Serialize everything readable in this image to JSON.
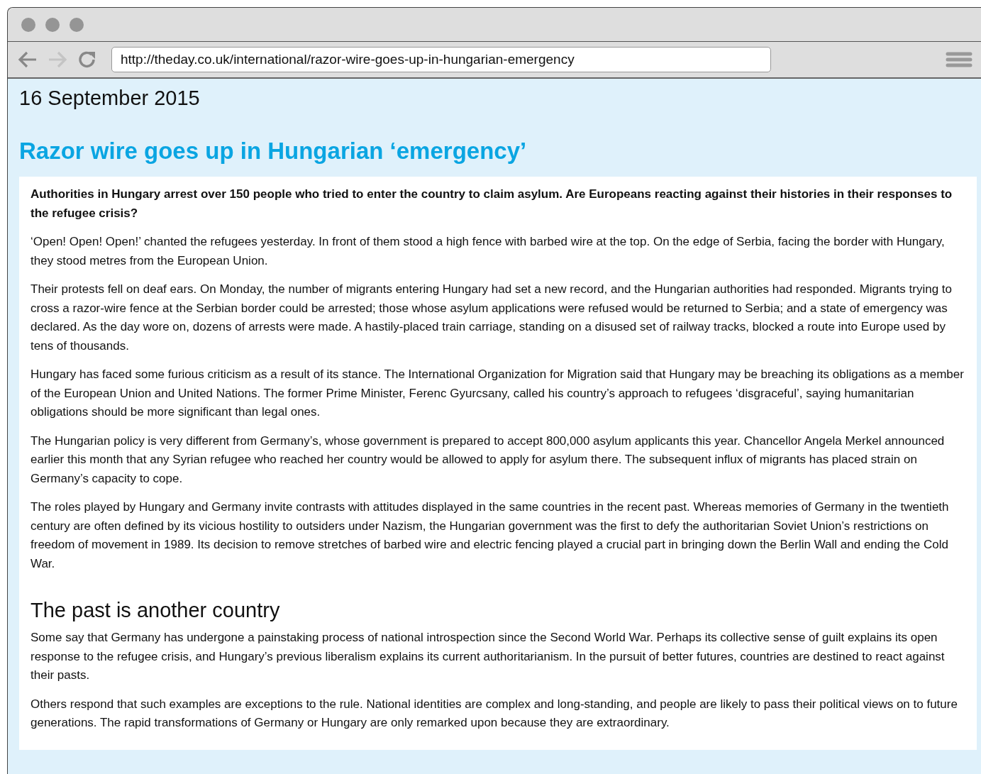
{
  "browser": {
    "url": "http://theday.co.uk/international/razor-wire-goes-up-in-hungarian-emergency"
  },
  "page": {
    "date": "16 September 2015",
    "title": "Razor wire goes up in Hungarian ‘emergency’",
    "blocks": [
      {
        "kind": "lead",
        "text": "Authorities in Hungary arrest over 150 people who tried to enter the country to claim asylum. Are Europeans reacting against their histories in their responses to the refugee crisis?"
      },
      {
        "kind": "paragraph",
        "text": "‘Open! Open! Open!’ chanted the refugees yesterday. In front of them stood a high fence with barbed wire at the top. On the edge of Serbia, facing the border with Hungary, they stood metres from the European Union."
      },
      {
        "kind": "paragraph",
        "text": "Their protests fell on deaf ears. On Monday, the number of migrants entering Hungary had set a new record, and the Hungarian authorities had responded. Migrants trying to cross a razor-wire fence at the Serbian border could be arrested; those whose asylum applications were refused would be returned to Serbia; and a state of emergency was declared. As the day wore on, dozens of arrests were made. A hastily-placed train carriage, standing on a disused set of railway tracks, blocked a route into Europe used by tens of thousands."
      },
      {
        "kind": "paragraph",
        "text": "Hungary has faced some furious criticism as a result of its stance. The International Organization for Migration said that Hungary may be breaching its obligations as a member of the European Union and United Nations. The former Prime Minister, Ferenc Gyurcsany, called his country’s approach to refugees ‘disgraceful’, saying humanitarian obligations should be more significant than legal ones."
      },
      {
        "kind": "paragraph",
        "text": "The Hungarian policy is very different from Germany’s, whose government is prepared to accept 800,000 asylum applicants this year. Chancellor Angela Merkel announced earlier this month that any Syrian refugee who reached her country would be allowed to apply for asylum there. The subsequent influx of migrants has placed strain on Germany’s capacity to cope."
      },
      {
        "kind": "paragraph",
        "text": "The roles played by Hungary and Germany invite contrasts with attitudes displayed in the same countries in the recent past. Whereas memories of Germany in the twentieth century are often defined by its vicious hostility to outsiders under Nazism, the Hungarian government was the first to defy the authoritarian Soviet Union’s restrictions on freedom of movement in 1989. Its decision to remove stretches of barbed wire and electric fencing played a crucial part in bringing down the Berlin Wall and ending the Cold War."
      },
      {
        "kind": "heading",
        "text": "The past is another country"
      },
      {
        "kind": "paragraph",
        "text": "Some say that Germany has undergone a painstaking process of national introspection since the Second World War. Perhaps its collective sense of guilt explains its open response to the refugee crisis, and Hungary’s previous liberalism explains its current authoritarianism. In the pursuit of better futures, countries are destined to react against their pasts."
      },
      {
        "kind": "paragraph",
        "text": "Others respond that such examples are exceptions to the rule. National identities are complex and long-standing, and people are likely to pass their political views on to future generations. The rapid transformations of Germany or Hungary are only remarked upon because they are extraordinary."
      }
    ]
  }
}
